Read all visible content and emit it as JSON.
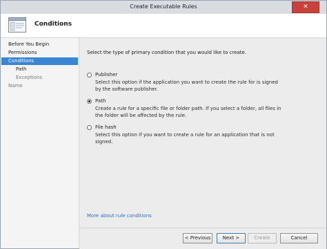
{
  "window": {
    "title": "Create Executable Rules",
    "close_glyph": "✕"
  },
  "header": {
    "title": "Conditions",
    "icon": "wizard-page-icon"
  },
  "sidebar": {
    "items": [
      {
        "label": "Before You Begin",
        "level": 0,
        "state": "normal"
      },
      {
        "label": "Permissions",
        "level": 0,
        "state": "normal"
      },
      {
        "label": "Conditions",
        "level": 0,
        "state": "active"
      },
      {
        "label": "Path",
        "level": 1,
        "state": "normal"
      },
      {
        "label": "Exceptions",
        "level": 1,
        "state": "dim"
      },
      {
        "label": "Name",
        "level": 0,
        "state": "dim"
      }
    ]
  },
  "main": {
    "intro": "Select the type of primary condition that you would like to create.",
    "options": [
      {
        "label": "Publisher",
        "checked": false,
        "description": "Select this option if the application you want to create the rule for is signed by the software publisher."
      },
      {
        "label": "Path",
        "checked": true,
        "description": "Create a rule for a specific file or folder path. If you select a folder, all files in the folder will be affected by the rule."
      },
      {
        "label": "File hash",
        "checked": false,
        "description": "Select this option if you want to create a rule for an application that is not signed."
      }
    ],
    "more_link": "More about rule conditions"
  },
  "footer": {
    "previous": "< Previous",
    "next": "Next >",
    "create": "Create",
    "cancel": "Cancel"
  },
  "colors": {
    "accent": "#3b86d3",
    "link": "#2a6fc0",
    "close": "#c8413a"
  }
}
